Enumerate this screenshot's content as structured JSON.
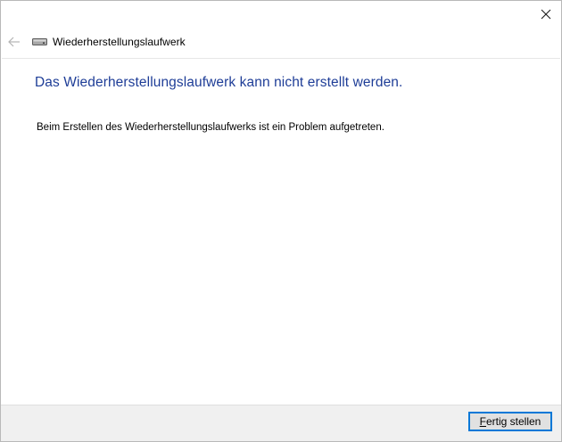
{
  "window": {
    "title": "Wiederherstellungslaufwerk"
  },
  "header": {
    "back_icon": "back-arrow-icon",
    "drive_icon": "drive-icon",
    "title": "Wiederherstellungslaufwerk"
  },
  "main": {
    "heading": "Das Wiederherstellungslaufwerk kann nicht erstellt werden.",
    "message": "Beim Erstellen des Wiederherstellungslaufwerks ist ein Problem aufgetreten."
  },
  "footer": {
    "finish_button": {
      "accelerator": "F",
      "label_rest": "ertig stellen"
    }
  },
  "colors": {
    "heading": "#1e3d97",
    "button_border": "#0078d7",
    "footer_bg": "#f0f0f0"
  }
}
